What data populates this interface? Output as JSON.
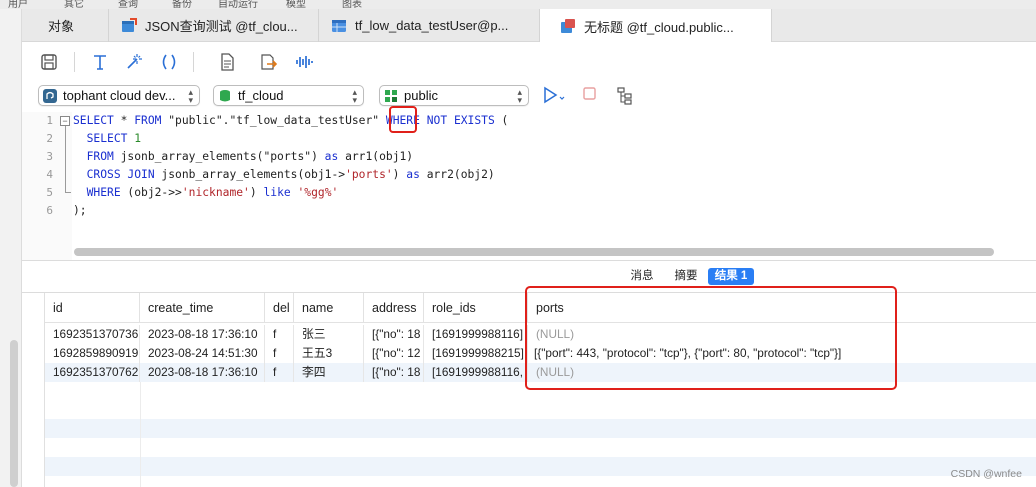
{
  "menu": [
    "用户",
    "其它",
    "查询",
    "备份",
    "自动运行",
    "模型",
    "图表"
  ],
  "tabs": [
    {
      "label": "对象"
    },
    {
      "label": "JSON查询测试 @tf_clou..."
    },
    {
      "label": "tf_low_data_testUser@p..."
    },
    {
      "label": "无标题 @tf_cloud.public..."
    }
  ],
  "selectors": {
    "connection": "tophant cloud dev...",
    "database": "tf_cloud",
    "schema": "public"
  },
  "editor": {
    "line_numbers": [
      "1",
      "2",
      "3",
      "4",
      "5",
      "6"
    ],
    "fold_symbol": "−"
  },
  "result_tabs": [
    "消息",
    "摘要",
    "结果 1"
  ],
  "table": {
    "columns": [
      "id",
      "create_time",
      "del",
      "name",
      "address",
      "role_ids",
      "ports"
    ],
    "rows": [
      [
        "1692351370736",
        "2023-08-18 17:36:10",
        "f",
        "张三",
        "[{\"no\": 18",
        "[1691999988116]",
        "(NULL)"
      ],
      [
        "1692859890919",
        "2023-08-24 14:51:30",
        "f",
        "王五3",
        "[{\"no\": 12",
        "[1691999988215]",
        "[{\"port\": 443, \"protocol\": \"tcp\"}, {\"port\": 80, \"protocol\": \"tcp\"}]"
      ],
      [
        "1692351370762",
        "2023-08-18 17:36:10",
        "f",
        "李四",
        "[{\"no\": 18",
        "[1691999988116,",
        "(NULL)"
      ]
    ]
  },
  "watermark": "CSDN @wnfee",
  "colors": {
    "accent": "#2a7ef4",
    "highlight": "#e0201a",
    "keyword": "#1a2fd0",
    "string": "#b0252a"
  }
}
